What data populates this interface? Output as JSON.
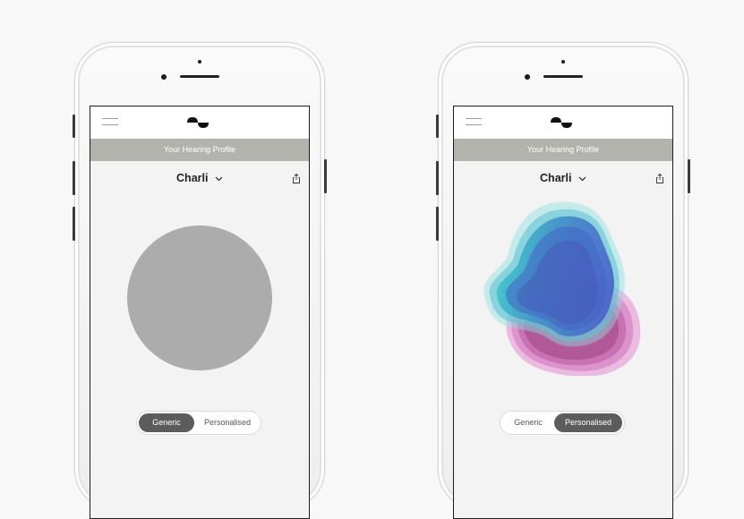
{
  "phones": [
    {
      "variant": "generic",
      "banner_title": "Your Hearing Profile",
      "profile_name": "Charli",
      "toggle": {
        "option_generic": "Generic",
        "option_personalised": "Personalised",
        "selected": "Generic"
      }
    },
    {
      "variant": "personalised",
      "banner_title": "Your Hearing Profile",
      "profile_name": "Charli",
      "toggle": {
        "option_generic": "Generic",
        "option_personalised": "Personalised",
        "selected": "Personalised"
      }
    }
  ],
  "icons": [
    "hamburger-menu-icon",
    "brand-logo-icon",
    "chevron-down-icon",
    "share-icon"
  ],
  "colors": {
    "banner": "#b3b3ae",
    "generic_circle": "#acacac",
    "toggle_active": "#5c5c5c",
    "blob_teal": "#3fc7c9",
    "blob_blue": "#4a6bd0",
    "blob_pink": "#d98cc8"
  }
}
